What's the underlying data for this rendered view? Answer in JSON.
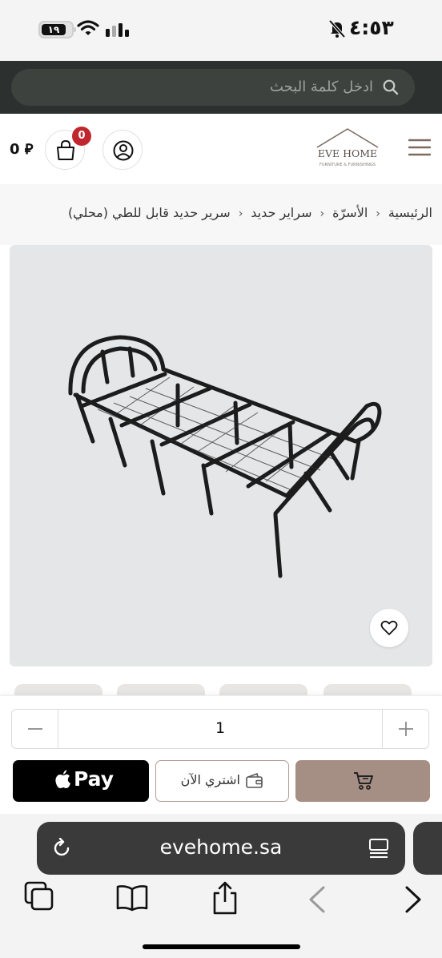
{
  "status_bar": {
    "time": "٤:٥٣",
    "battery_level": "١٩"
  },
  "search": {
    "placeholder": "ادخل كلمة البحث"
  },
  "header": {
    "cart_total": "0 ⃁",
    "cart_count": "0",
    "logo_title": "EVE HOME",
    "logo_subtitle": "FURNITURE & FURNISHINGS"
  },
  "breadcrumb": {
    "items": [
      "الرئيسية",
      "الأسرّة",
      "سراير حديد",
      "سرير حديد قابل للطي (محلي)"
    ]
  },
  "purchase": {
    "quantity": "1",
    "apple_pay_label": "Pay",
    "buy_now_label": "اشتري الآن"
  },
  "browser": {
    "url": "evehome.sa"
  },
  "colors": {
    "accent": "#a58e84",
    "badge": "#c0262d",
    "header_dark": "#2c302e"
  }
}
